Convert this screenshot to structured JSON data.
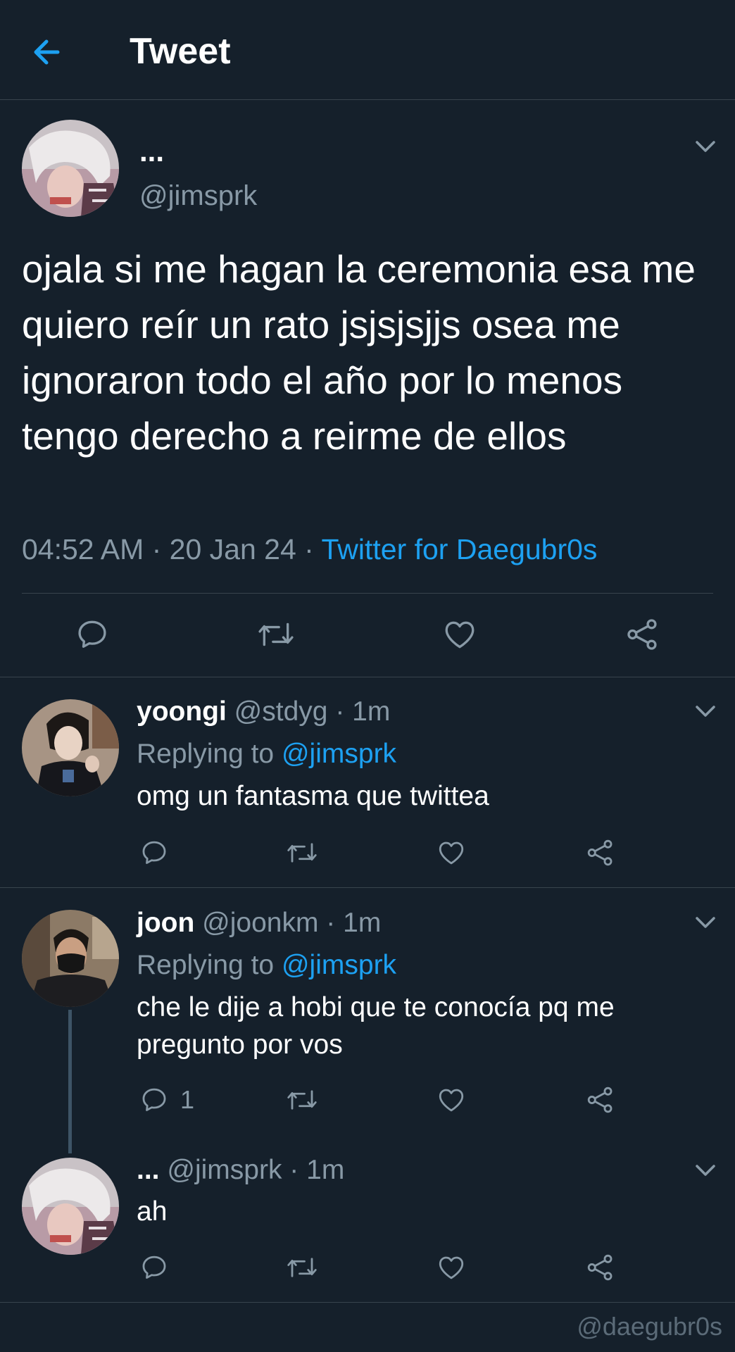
{
  "header": {
    "title": "Tweet",
    "back_icon": "arrow-left-icon",
    "accent_color": "#1da1f2"
  },
  "main_tweet": {
    "name": "...",
    "handle": "@jimsprk",
    "text": "ojala si me hagan la ceremonia esa me quiero reír un rato jsjsjsjjs osea me ignoraron todo el año por lo menos tengo derecho a reirme de ellos",
    "time": "04:52 AM",
    "date": "20 Jan 24",
    "source": "Twitter for Daegubr0s",
    "actions": [
      "reply-icon",
      "retweet-icon",
      "like-icon",
      "share-icon"
    ]
  },
  "replies": [
    {
      "name": "yoongi",
      "handle": "@stdyg",
      "time": "1m",
      "replying_label": "Replying to",
      "replying_to": "@jimsprk",
      "text": "omg un fantasma que twittea",
      "reply_count": ""
    },
    {
      "name": "joon",
      "handle": "@joonkm",
      "time": "1m",
      "replying_label": "Replying to",
      "replying_to": "@jimsprk",
      "text": "che le dije a hobi que te conocía pq me pregunto por vos",
      "reply_count": "1"
    },
    {
      "name": "...",
      "handle": "@jimsprk",
      "time": "1m",
      "text": "ah",
      "reply_count": ""
    }
  ],
  "separator": " · ",
  "watermark": "@daegubr0s",
  "colors": {
    "background": "#15202b",
    "divider": "#38444d",
    "muted": "#8899a6",
    "link": "#1da1f2"
  }
}
